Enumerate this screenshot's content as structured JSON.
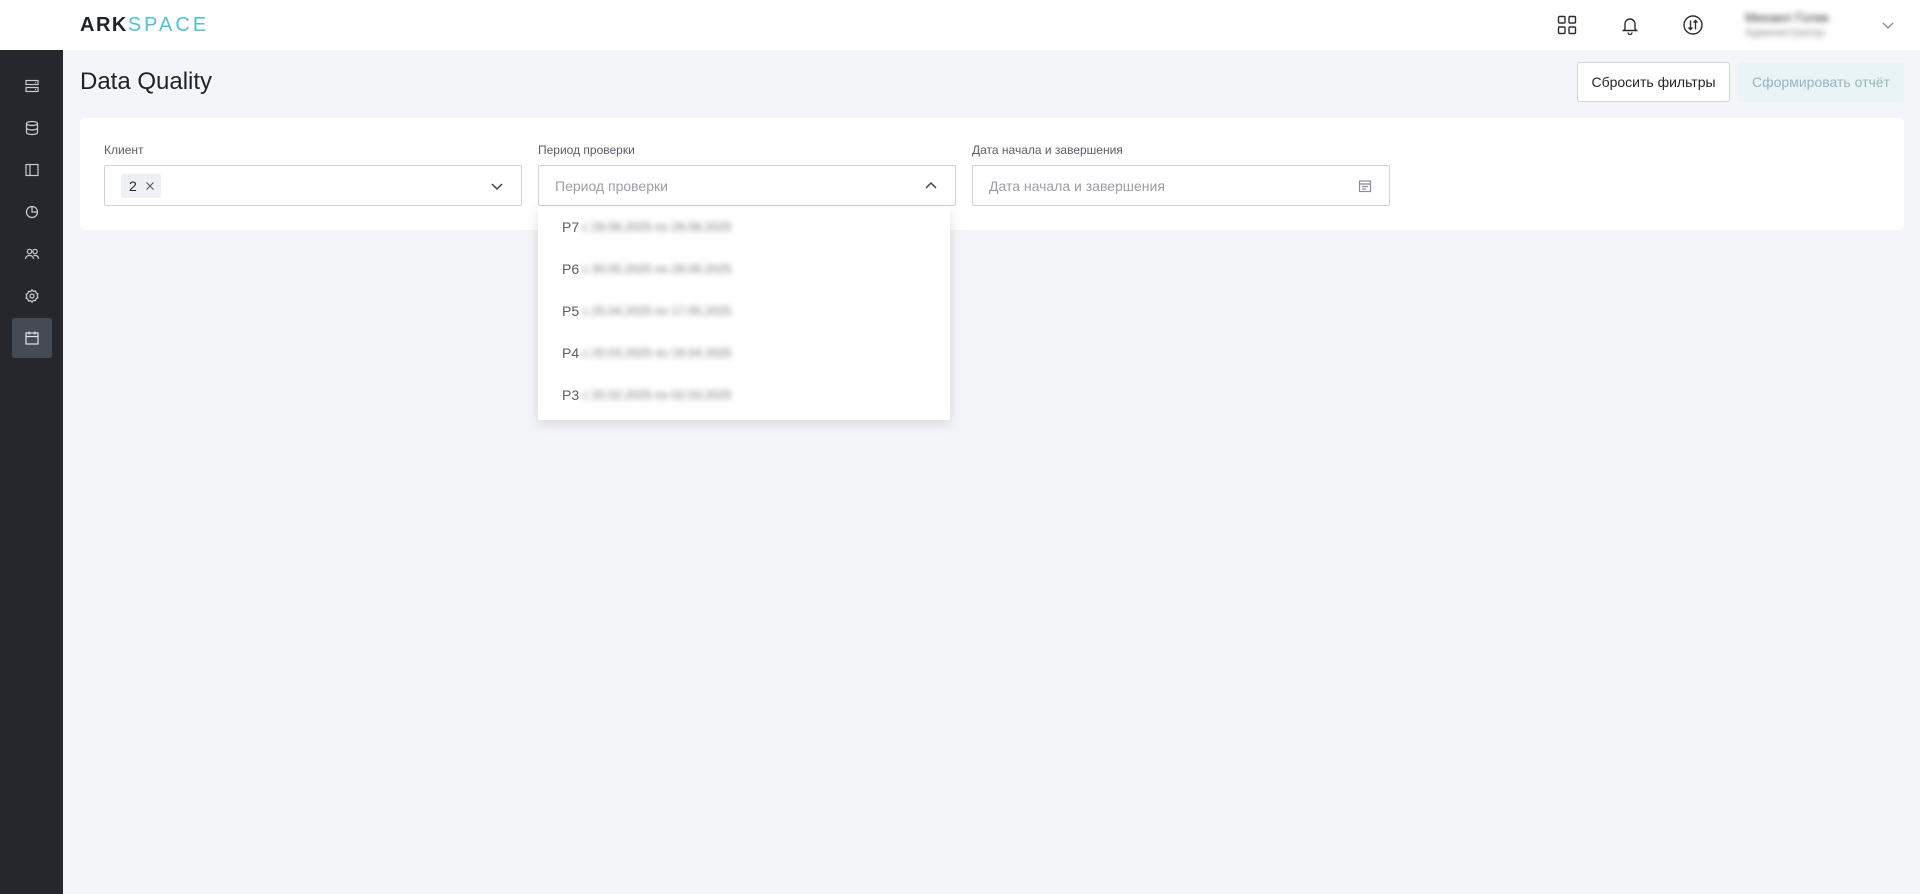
{
  "app": {
    "logo_ark": "ARK",
    "logo_space": "SPACE"
  },
  "topbar": {
    "icons": [
      "apps-grid-icon",
      "bell-icon",
      "sync-icon"
    ],
    "user_name": "Михаил Голик",
    "user_role": "Администратор"
  },
  "sidebar": {
    "items": [
      {
        "icon": "server-list-icon",
        "active": false
      },
      {
        "icon": "database-icon",
        "active": false
      },
      {
        "icon": "panel-icon",
        "active": false
      },
      {
        "icon": "pie-chart-icon",
        "active": false
      },
      {
        "icon": "users-icon",
        "active": false
      },
      {
        "icon": "settings-icon",
        "active": false
      },
      {
        "icon": "calendar-icon",
        "active": true
      }
    ]
  },
  "header": {
    "title": "Data Quality",
    "reset_label": "Сбросить фильтры",
    "report_label": "Сформировать отчёт"
  },
  "filters": {
    "client": {
      "label": "Клиент",
      "tag": "2"
    },
    "period": {
      "label": "Период проверки",
      "placeholder": "Период проверки",
      "options": [
        {
          "code": "P7",
          "range": "с 29.06.2025 по 29.08.2025"
        },
        {
          "code": "P6",
          "range": "с 30.05.2025 по 28.06.2025"
        },
        {
          "code": "P5",
          "range": "с 25.04.2025 по 17.05.2025"
        },
        {
          "code": "P4",
          "range": "с 20.03.2025 по 19.04.2025"
        },
        {
          "code": "P3",
          "range": "с 20.02.2025 по 02.03.2025"
        }
      ]
    },
    "dates": {
      "label": "Дата начала и завершения",
      "placeholder": "Дата начала и завершения"
    }
  },
  "colors": {
    "sidebar_bg": "#25272d",
    "accent": "#4ec3d6",
    "page_bg": "#f4f5f9"
  }
}
